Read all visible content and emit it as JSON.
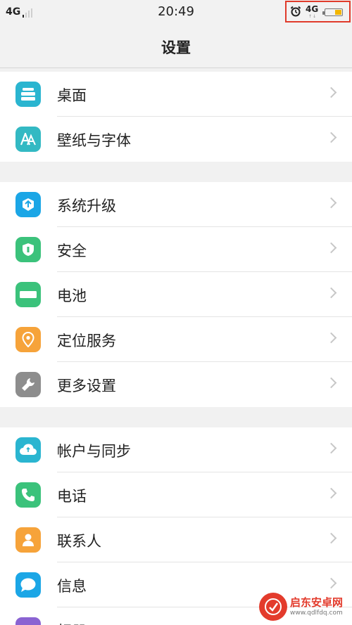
{
  "status": {
    "left_network": "4G",
    "time": "20:49",
    "right_network": "4G",
    "right_arrows": "↑↓",
    "battery_level": 0.4
  },
  "nav": {
    "title": "设置"
  },
  "groups": [
    {
      "items": [
        {
          "label": "桌面",
          "icon": "desktop-icon",
          "color": "#2ab5d0"
        },
        {
          "label": "壁纸与字体",
          "icon": "font-icon",
          "color": "#33b9c3"
        }
      ]
    },
    {
      "items": [
        {
          "label": "系统升级",
          "icon": "system-upgrade-icon",
          "color": "#1ba6e6"
        },
        {
          "label": "安全",
          "icon": "shield-icon",
          "color": "#3bc27b"
        },
        {
          "label": "电池",
          "icon": "battery-icon",
          "color": "#3bc27b"
        },
        {
          "label": "定位服务",
          "icon": "location-icon",
          "color": "#f6a33a"
        },
        {
          "label": "更多设置",
          "icon": "wrench-icon",
          "color": "#8d8d8d"
        }
      ]
    },
    {
      "items": [
        {
          "label": "帐户与同步",
          "icon": "cloud-icon",
          "color": "#2ab5d0"
        },
        {
          "label": "电话",
          "icon": "phone-icon",
          "color": "#3bc27b"
        },
        {
          "label": "联系人",
          "icon": "contact-icon",
          "color": "#f6a33a"
        },
        {
          "label": "信息",
          "icon": "message-icon",
          "color": "#1ba6e6"
        },
        {
          "label": "相册",
          "icon": "album-icon",
          "color": "#8a63d2"
        }
      ]
    }
  ],
  "watermark": {
    "name": "启东安卓网",
    "url": "www.qdlfdq.com"
  }
}
